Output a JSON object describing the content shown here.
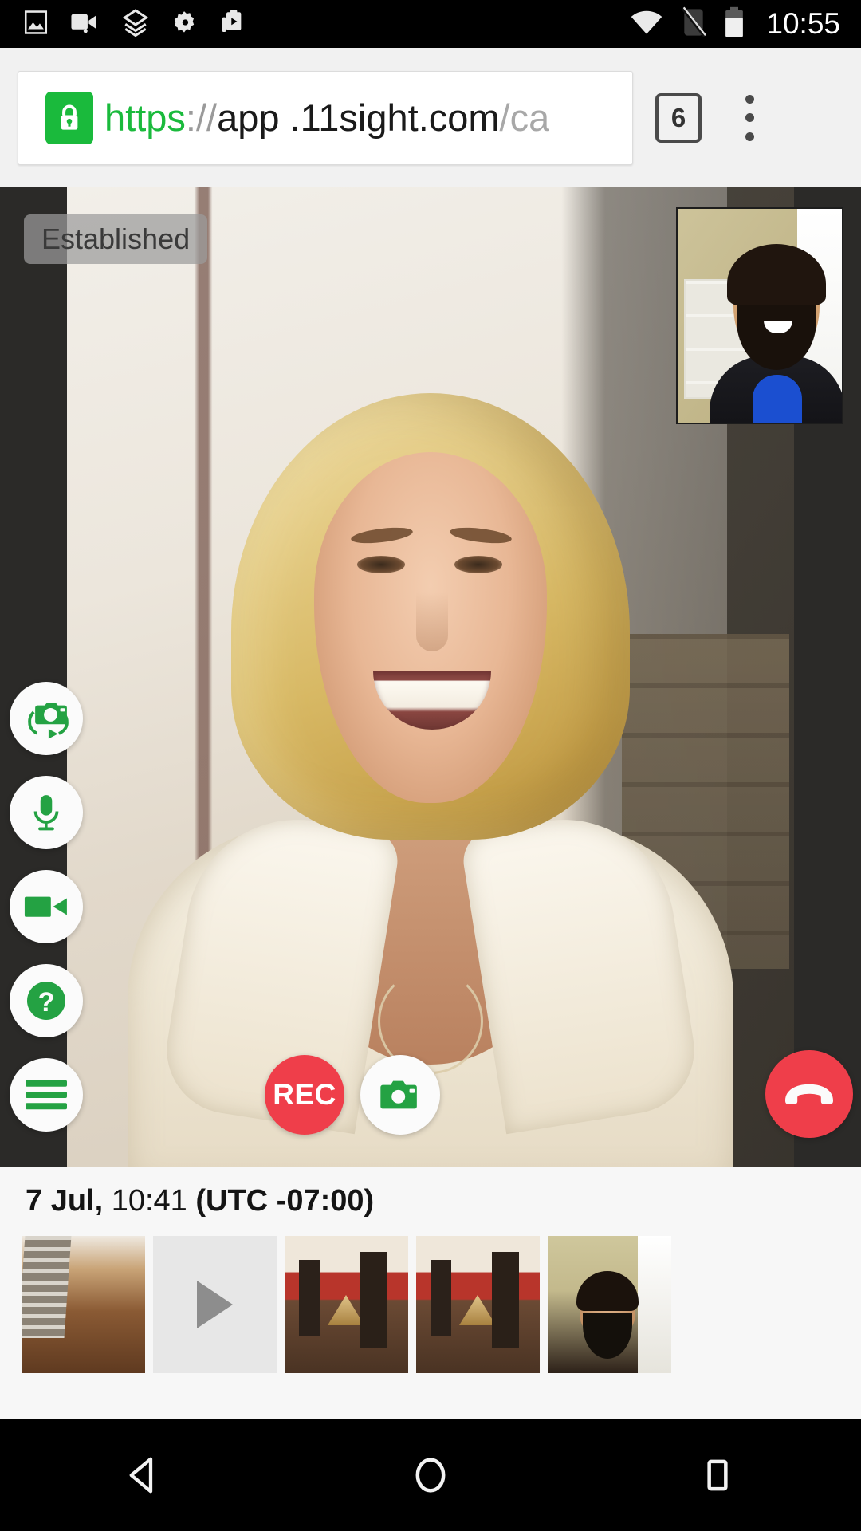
{
  "status_bar": {
    "time": "10:55",
    "icons": [
      {
        "name": "gallery-icon",
        "label": "Gallery"
      },
      {
        "name": "video-recorder-icon",
        "label": "Video recorder"
      },
      {
        "name": "layers-icon",
        "label": "Layers"
      },
      {
        "name": "gear-icon",
        "label": "Settings"
      },
      {
        "name": "clipboard-play-icon",
        "label": "Clipboard"
      }
    ],
    "right_icons": [
      {
        "name": "wifi-icon",
        "label": "Wi-Fi"
      },
      {
        "name": "no-sim-icon",
        "label": "No SIM"
      },
      {
        "name": "battery-icon",
        "label": "Battery"
      }
    ]
  },
  "browser": {
    "url_scheme": "https",
    "url_separator": "://",
    "url_host": "app .11sight.com",
    "url_path": "/ca",
    "url_full": "https:// app .11sight.com/ca",
    "lock_icon": "lock-icon",
    "tab_count": "6",
    "menu_icon": "kebab-menu-icon"
  },
  "call": {
    "status_label": "Established",
    "accent_green": "#1aba3c",
    "accent_red": "#ef3e4a",
    "controls_left": [
      {
        "name": "switch-camera-button",
        "label": "Switch camera"
      },
      {
        "name": "microphone-button",
        "label": "Microphone"
      },
      {
        "name": "video-camera-button",
        "label": "Video"
      },
      {
        "name": "help-button",
        "label": "Help"
      },
      {
        "name": "menu-button",
        "label": "Menu"
      }
    ],
    "record_label": "REC",
    "snapshot_label": "Snapshot",
    "hangup_label": "End call"
  },
  "gallery": {
    "date_bold_1": "7 Jul,",
    "time_plain": "10:41",
    "date_bold_2": "(UTC -07:00)",
    "thumbnails": [
      {
        "name": "thumbnail-hallway",
        "type": "photo",
        "label": "Hallway floor"
      },
      {
        "name": "thumbnail-video",
        "type": "video",
        "label": "Recorded video"
      },
      {
        "name": "thumbnail-dining-1",
        "type": "photo",
        "label": "Dining table"
      },
      {
        "name": "thumbnail-dining-2",
        "type": "photo",
        "label": "Dining table"
      },
      {
        "name": "thumbnail-person",
        "type": "photo",
        "label": "Person"
      }
    ]
  },
  "nav_bar": {
    "back": "back-button",
    "home": "home-button",
    "recents": "recents-button"
  }
}
